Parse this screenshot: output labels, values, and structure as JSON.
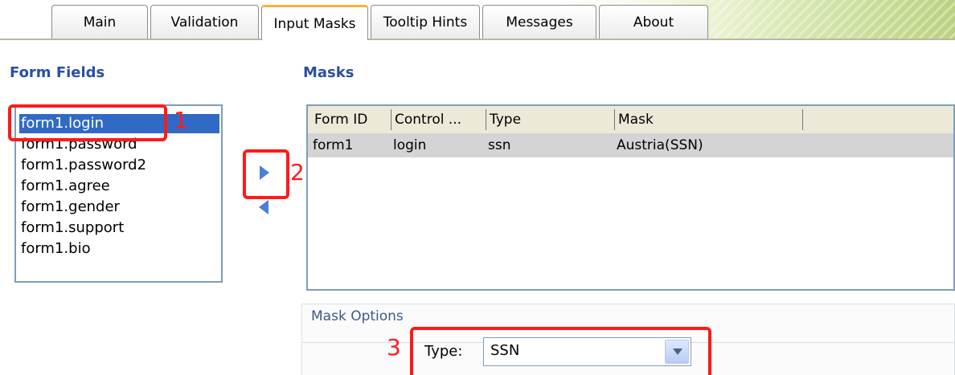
{
  "tabs": [
    "Main",
    "Validation",
    "Input Masks",
    "Tooltip Hints",
    "Messages",
    "About"
  ],
  "form_fields": {
    "title": "Form Fields",
    "items": [
      "form1.login",
      "form1.password",
      "form1.password2",
      "form1.agree",
      "form1.gender",
      "form1.support",
      "form1.bio"
    ]
  },
  "masks": {
    "title": "Masks",
    "columns": [
      "Form ID",
      "Control ...",
      "Type",
      "Mask"
    ],
    "rows": [
      {
        "form_id": "form1",
        "control": "login",
        "type": "ssn",
        "mask": "Austria(SSN)"
      }
    ]
  },
  "mask_options": {
    "title": "Mask Options",
    "type_label": "Type:",
    "type_value": "SSN"
  },
  "callouts": [
    "1",
    "2",
    "3"
  ],
  "colors": {
    "accent_tab": "#f4b43a",
    "section_title": "#2b4fa3",
    "selection": "#316ac5",
    "callout_red": "#ff1a1a"
  },
  "icons": {
    "move_right": "triangle-right-icon",
    "move_left": "triangle-left-icon",
    "dropdown": "chevron-down-icon"
  }
}
